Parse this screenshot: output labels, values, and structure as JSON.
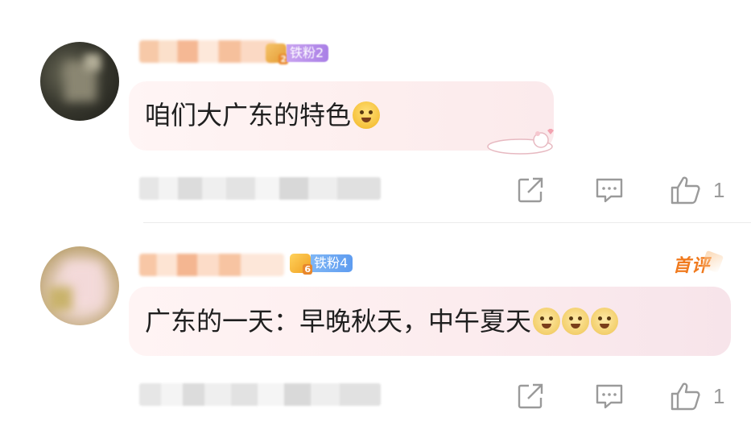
{
  "comments": [
    {
      "fan_badge": "铁粉2",
      "fan_level": "2",
      "text": "咱们大广东的特色",
      "emoji": "screaming-face-emoji",
      "like_count": "1"
    },
    {
      "fan_badge": "铁粉4",
      "fan_level": "6",
      "first_comment_label": "首评",
      "text": "广东的一天：早晚秋天，中午夏天",
      "emoji": "doge-emoji",
      "like_count": "1"
    }
  ],
  "icons": {
    "share": "share-icon",
    "reply": "reply-icon",
    "like": "thumbs-up-icon"
  },
  "colors": {
    "fan_badge_1": "#b18bea",
    "fan_badge_2": "#6aa6f2",
    "first_badge": "#f07a1e",
    "bubble": "#fdeeee",
    "action_icon": "#9a9a9a"
  }
}
